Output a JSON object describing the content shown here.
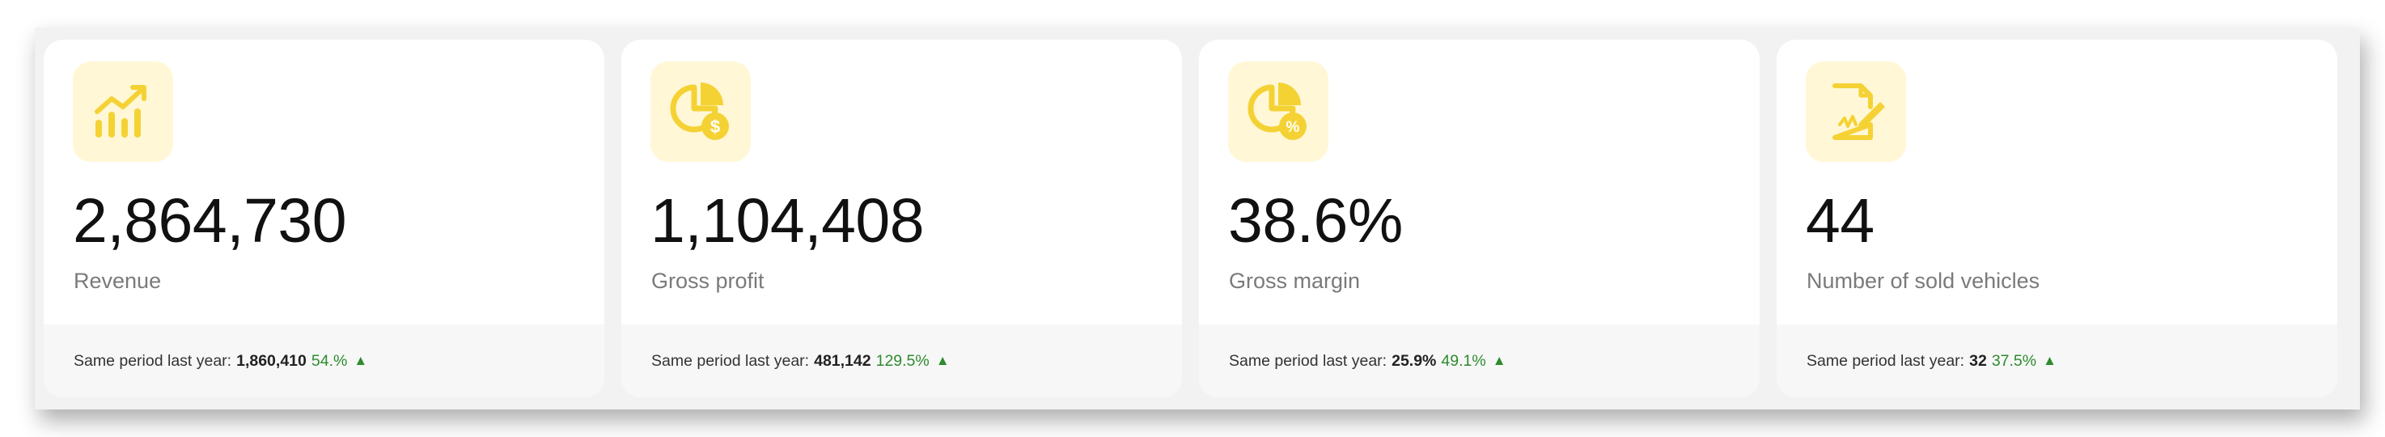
{
  "cards": [
    {
      "icon": "bar-chart-trend-icon",
      "value": "2,864,730",
      "label": "Revenue",
      "footer_label": "Same period last year:",
      "previous_value": "1,860,410",
      "change": "54.%",
      "trend": "up"
    },
    {
      "icon": "pie-chart-dollar-icon",
      "value": "1,104,408",
      "label": "Gross profit",
      "footer_label": "Same period last year:",
      "previous_value": "481,142",
      "change": "129.5%",
      "trend": "up"
    },
    {
      "icon": "pie-chart-percent-icon",
      "value": "38.6%",
      "label": "Gross margin",
      "footer_label": "Same period last year:",
      "previous_value": "25.9%",
      "change": "49.1%",
      "trend": "up"
    },
    {
      "icon": "document-signature-icon",
      "value": "44",
      "label": "Number of sold vehicles",
      "footer_label": "Same period last year:",
      "previous_value": "32",
      "change": "37.5%",
      "trend": "up"
    }
  ],
  "colors": {
    "icon_fill": "#f5d234",
    "icon_background": "#fff7d6",
    "positive": "#2e8b2e"
  }
}
